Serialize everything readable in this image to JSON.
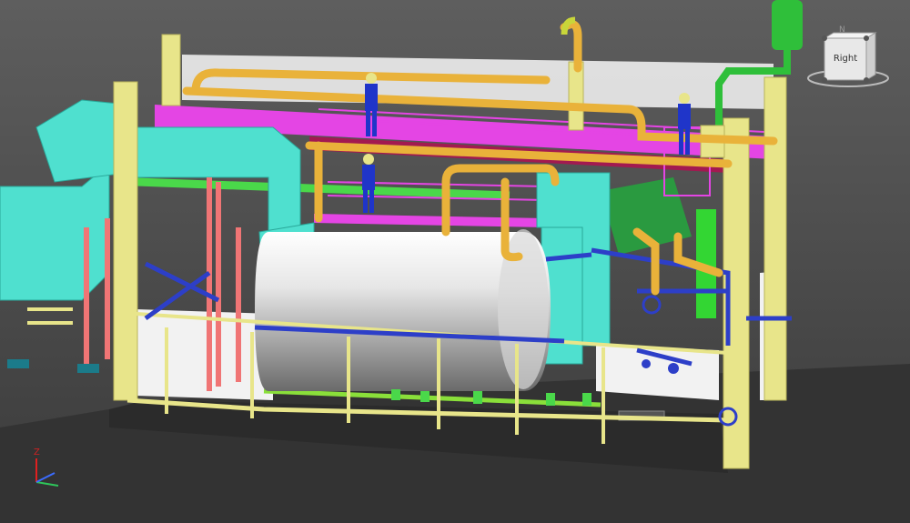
{
  "viewport": {
    "background_top": "#5a5a5a",
    "background_bottom": "#353535",
    "floor_color": "#303030"
  },
  "navigation_cube": {
    "face_label": "Right",
    "compass_label": "N",
    "icon": "view-cube-icon"
  },
  "axis_triad": {
    "z_label": "Z",
    "x_color": "#3b6cff",
    "y_color": "#2ec45a",
    "z_color": "#e02020"
  },
  "scene": {
    "colors": {
      "structure_yellow": "#e8e58a",
      "ductwork_cyan": "#4fe0cf",
      "boiler_gray": "#cfcfcf",
      "pipe_orange": "#e9b23a",
      "walkway_magenta": "#e445e4",
      "pipe_blue": "#2d3fc8",
      "pipe_green": "#4ad84a",
      "support_salmon": "#f07575",
      "figure_blue": "#1f35c9",
      "white_panel": "#f2f2f2",
      "floor_slab": "#2b2b2b"
    },
    "icons": {
      "operator_figure": "person-icon",
      "valve": "valve-icon"
    }
  }
}
